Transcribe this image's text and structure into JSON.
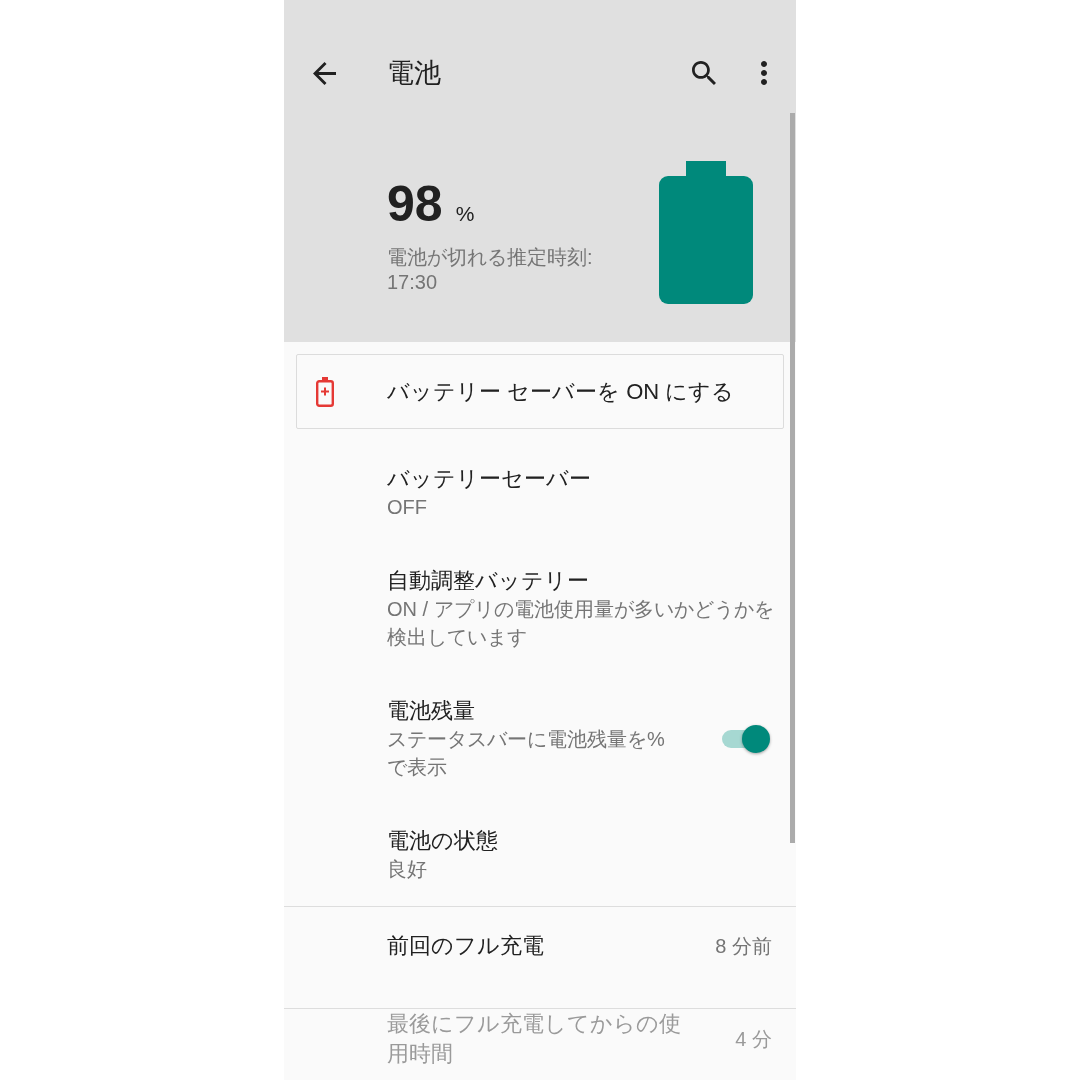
{
  "app_bar": {
    "title": "電池"
  },
  "battery": {
    "percent": "98",
    "unit": "%",
    "estimate": "電池が切れる推定時刻: 17:30"
  },
  "suggestion": {
    "text": "バッテリー セーバーを ON にする"
  },
  "settings": [
    {
      "kind": "text",
      "title": "バッテリーセーバー",
      "summary": "OFF"
    },
    {
      "kind": "text",
      "title": "自動調整バッテリー",
      "summary": "ON / アプリの電池使用量が多いかどうかを検出しています"
    },
    {
      "kind": "switch",
      "title": "電池残量",
      "summary": "ステータスバーに電池残量を%で表示",
      "on": true
    },
    {
      "kind": "text",
      "title": "電池の状態",
      "summary": "良好"
    }
  ],
  "usage": [
    {
      "title": "前回のフル充電",
      "value": "8 分前",
      "faded": false
    },
    {
      "title": "最後にフル充電してからの使用時間",
      "value": "4 分",
      "faded": true
    }
  ]
}
